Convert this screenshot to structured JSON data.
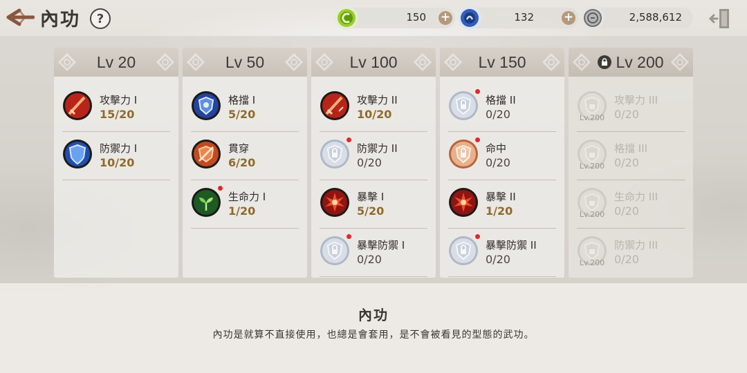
{
  "header": {
    "title": "內功",
    "help_label": "?",
    "currencies": [
      {
        "icon": "green-orb-icon",
        "amount": "150"
      },
      {
        "icon": "blue-orb-icon",
        "amount": "132"
      },
      {
        "icon": "silver-coin-icon",
        "amount": "2,588,612"
      }
    ],
    "plus_label": "+"
  },
  "columns": [
    {
      "level": "Lv 20",
      "locked": false,
      "skills": [
        {
          "name": "攻擊力 I",
          "value": "15/20",
          "icon": "sword-icon",
          "dot": false
        },
        {
          "name": "防禦力 I",
          "value": "10/20",
          "icon": "shield-icon",
          "dot": false
        }
      ]
    },
    {
      "level": "Lv 50",
      "locked": false,
      "skills": [
        {
          "name": "格擋 I",
          "value": "5/20",
          "icon": "block-shield-icon",
          "dot": false
        },
        {
          "name": "貫穿",
          "value": "6/20",
          "icon": "pierce-icon",
          "dot": false
        },
        {
          "name": "生命力 I",
          "value": "1/20",
          "icon": "sprout-icon",
          "dot": true
        }
      ]
    },
    {
      "level": "Lv 100",
      "locked": false,
      "skills": [
        {
          "name": "攻擊力 II",
          "value": "10/20",
          "icon": "sword-icon",
          "dot": false
        },
        {
          "name": "防禦力 II",
          "value": "0/20",
          "icon": "locked-skill-icon",
          "dot": true
        },
        {
          "name": "暴擊 I",
          "value": "5/20",
          "icon": "burst-icon",
          "dot": false
        },
        {
          "name": "暴擊防禦 I",
          "value": "0/20",
          "icon": "locked-skill-icon",
          "dot": true
        }
      ]
    },
    {
      "level": "Lv 150",
      "locked": false,
      "skills": [
        {
          "name": "格擋 II",
          "value": "0/20",
          "icon": "locked-skill-icon",
          "dot": true
        },
        {
          "name": "命中",
          "value": "0/20",
          "icon": "locked-target-icon",
          "dot": true
        },
        {
          "name": "暴擊 II",
          "value": "1/20",
          "icon": "burst-icon",
          "dot": false
        },
        {
          "name": "暴擊防禦 II",
          "value": "0/20",
          "icon": "locked-skill-icon",
          "dot": true
        }
      ]
    },
    {
      "level": "Lv 200",
      "locked": true,
      "skills": [
        {
          "name": "攻擊力 III",
          "value": "0/20",
          "icon": "locked-skill-icon",
          "tag": "Lv.200"
        },
        {
          "name": "格擋 III",
          "value": "0/20",
          "icon": "locked-skill-icon",
          "tag": "Lv.200"
        },
        {
          "name": "生命力 III",
          "value": "0/20",
          "icon": "locked-skill-icon",
          "tag": "Lv.200"
        },
        {
          "name": "防禦力 III",
          "value": "0/20",
          "icon": "locked-skill-icon",
          "tag": "Lv.200"
        }
      ]
    }
  ],
  "footer": {
    "title": "內功",
    "description": "內功是就算不直接使用，也總是會套用，是不會被看見的型態的武功。"
  },
  "colors": {
    "accent_value": "#8f6a2c",
    "notification_dot": "#e02828"
  }
}
